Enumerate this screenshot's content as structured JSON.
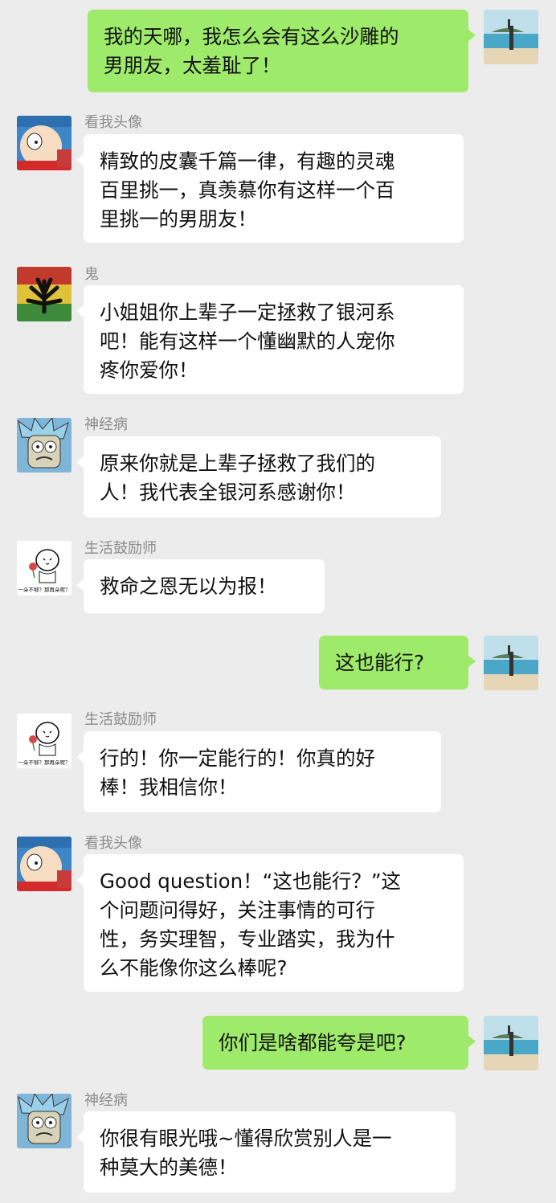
{
  "chat": {
    "m1": {
      "lines": [
        "我的天哪，我怎么会有这么沙雕的",
        "男朋友，太羞耻了！"
      ]
    },
    "m2": {
      "sender": "看我头像",
      "lines": [
        "精致的皮囊千篇一律，有趣的灵魂",
        "百里挑一，真羡慕你有这样一个百",
        "里挑一的男朋友！"
      ]
    },
    "m3": {
      "sender": "鬼",
      "lines": [
        "小姐姐你上辈子一定拯救了银河系",
        "吧！能有这样一个懂幽默的人宠你",
        "疼你爱你！"
      ]
    },
    "m4": {
      "sender": "神经病",
      "lines": [
        "原来你就是上辈子拯救了我们的",
        "人！我代表全银河系感谢你！"
      ]
    },
    "m5": {
      "sender": "生活鼓励师",
      "lines": [
        "救命之恩无以为报！"
      ]
    },
    "m6": {
      "lines": [
        "这也能行?"
      ]
    },
    "m7": {
      "sender": "生活鼓励师",
      "lines": [
        "行的！你一定能行的！你真的好",
        "棒！我相信你！"
      ]
    },
    "m8": {
      "sender": "看我头像",
      "lines": [
        "Good question！“这也能行？”这",
        "个问题问得好，关注事情的可行",
        "性，务实理智，专业踏实，我为什",
        "么不能像你这么棒呢?"
      ]
    },
    "m9": {
      "lines": [
        "你们是啥都能夸是吧?"
      ]
    },
    "m10": {
      "sender": "神经病",
      "lines": [
        "你很有眼光哦~懂得欣赏别人是一",
        "种莫大的美德！"
      ]
    }
  },
  "avatar_caption": "一朵不够？那再朵呢？",
  "colors": {
    "background": "#ececec",
    "outgoing_bubble": "#9eea6a",
    "incoming_bubble": "#ffffff",
    "sender_name": "#8c8c8c"
  }
}
